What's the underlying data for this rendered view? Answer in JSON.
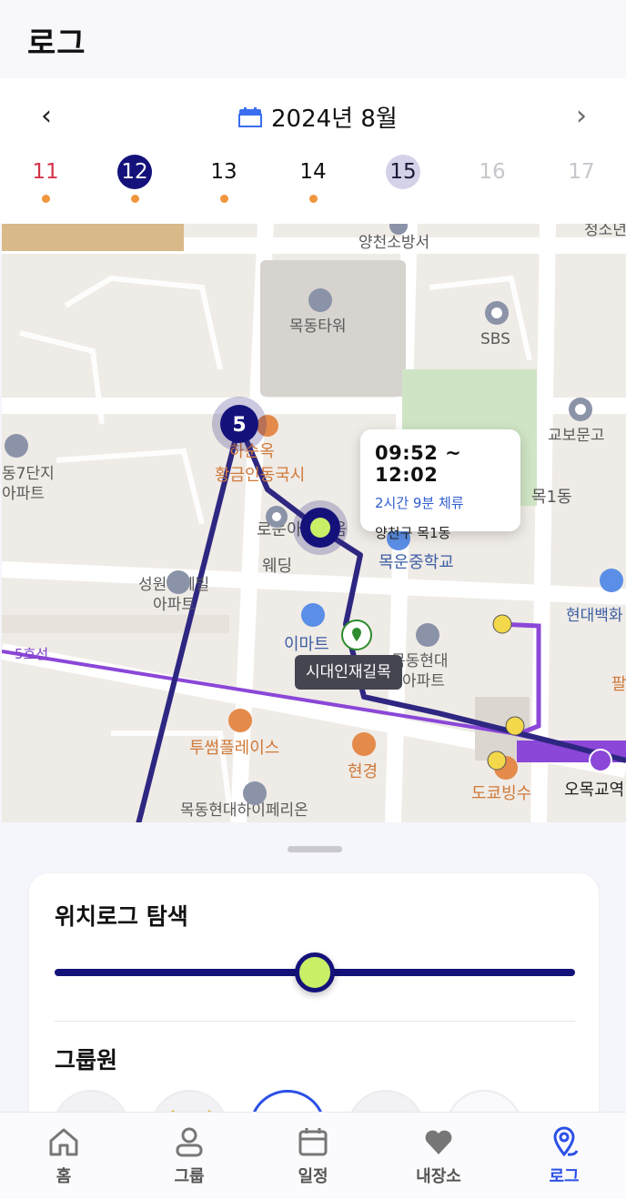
{
  "header": {
    "title": "로그"
  },
  "calendar": {
    "month_label": "2024년 8월",
    "prev_label": "‹",
    "next_label": "›",
    "days": [
      {
        "num": "11",
        "state": "sunday",
        "has_log": true
      },
      {
        "num": "12",
        "state": "selected",
        "has_log": true
      },
      {
        "num": "13",
        "state": "normal",
        "has_log": true
      },
      {
        "num": "14",
        "state": "normal",
        "has_log": true
      },
      {
        "num": "15",
        "state": "today",
        "has_log": false
      },
      {
        "num": "16",
        "state": "disabled",
        "has_log": false
      },
      {
        "num": "17",
        "state": "disabled",
        "has_log": false
      }
    ]
  },
  "map": {
    "labels": {
      "fire_station": "양천소방서",
      "tower": "목동타워",
      "sbs": "SBS",
      "kyobo": "교보문고",
      "noodle_1": "하순옥",
      "noodle_2": "황금인동국시",
      "apt_left_1": "동7단지",
      "apt_left_2": "아파트",
      "mok1dong": "목1동",
      "wedding_1": "로운아뜨리움",
      "wedding_2": "웨딩",
      "school": "목운중학교",
      "hyundai_dept": "현대백화",
      "seongwon_1": "성원상떼빌",
      "seongwon_2": "아파트",
      "emart": "이마트",
      "line5": "5호선",
      "mokdong_apt_1": "목동현대",
      "mokdong_apt_2": "아파트",
      "twosome": "투썸플레이스",
      "hyungyeong": "현경",
      "dokyo": "도쿄빙수",
      "omokgyo": "오목교역",
      "imperial": "목동현대하이페리온",
      "sae": "청소년",
      "pal": "팔"
    },
    "cluster_count": "5",
    "tooltip": {
      "time_range": "09:52 ~ 12:02",
      "stay": "2시간 9분 체류",
      "address": "양천구 목1동"
    },
    "place_label": "시대인재길목",
    "colors": {
      "route": "#2e2781",
      "line5": "#8b47d8",
      "current": "#c9ef66"
    }
  },
  "sheet": {
    "search_title": "위치로그 탐색",
    "slider_value": 0.5,
    "members_title": "그룹원",
    "members": [
      {
        "name": "member-1"
      },
      {
        "name": "member-2"
      },
      {
        "name": "member-3",
        "selected": true
      },
      {
        "name": "member-4"
      },
      {
        "name": "member-5"
      }
    ]
  },
  "tabbar": {
    "tabs": [
      {
        "label": "홈",
        "icon": "home-icon"
      },
      {
        "label": "그룹",
        "icon": "person-icon"
      },
      {
        "label": "일정",
        "icon": "calendar-icon"
      },
      {
        "label": "내장소",
        "icon": "heart-icon"
      },
      {
        "label": "로그",
        "icon": "location-pin-icon",
        "active": true
      }
    ]
  }
}
